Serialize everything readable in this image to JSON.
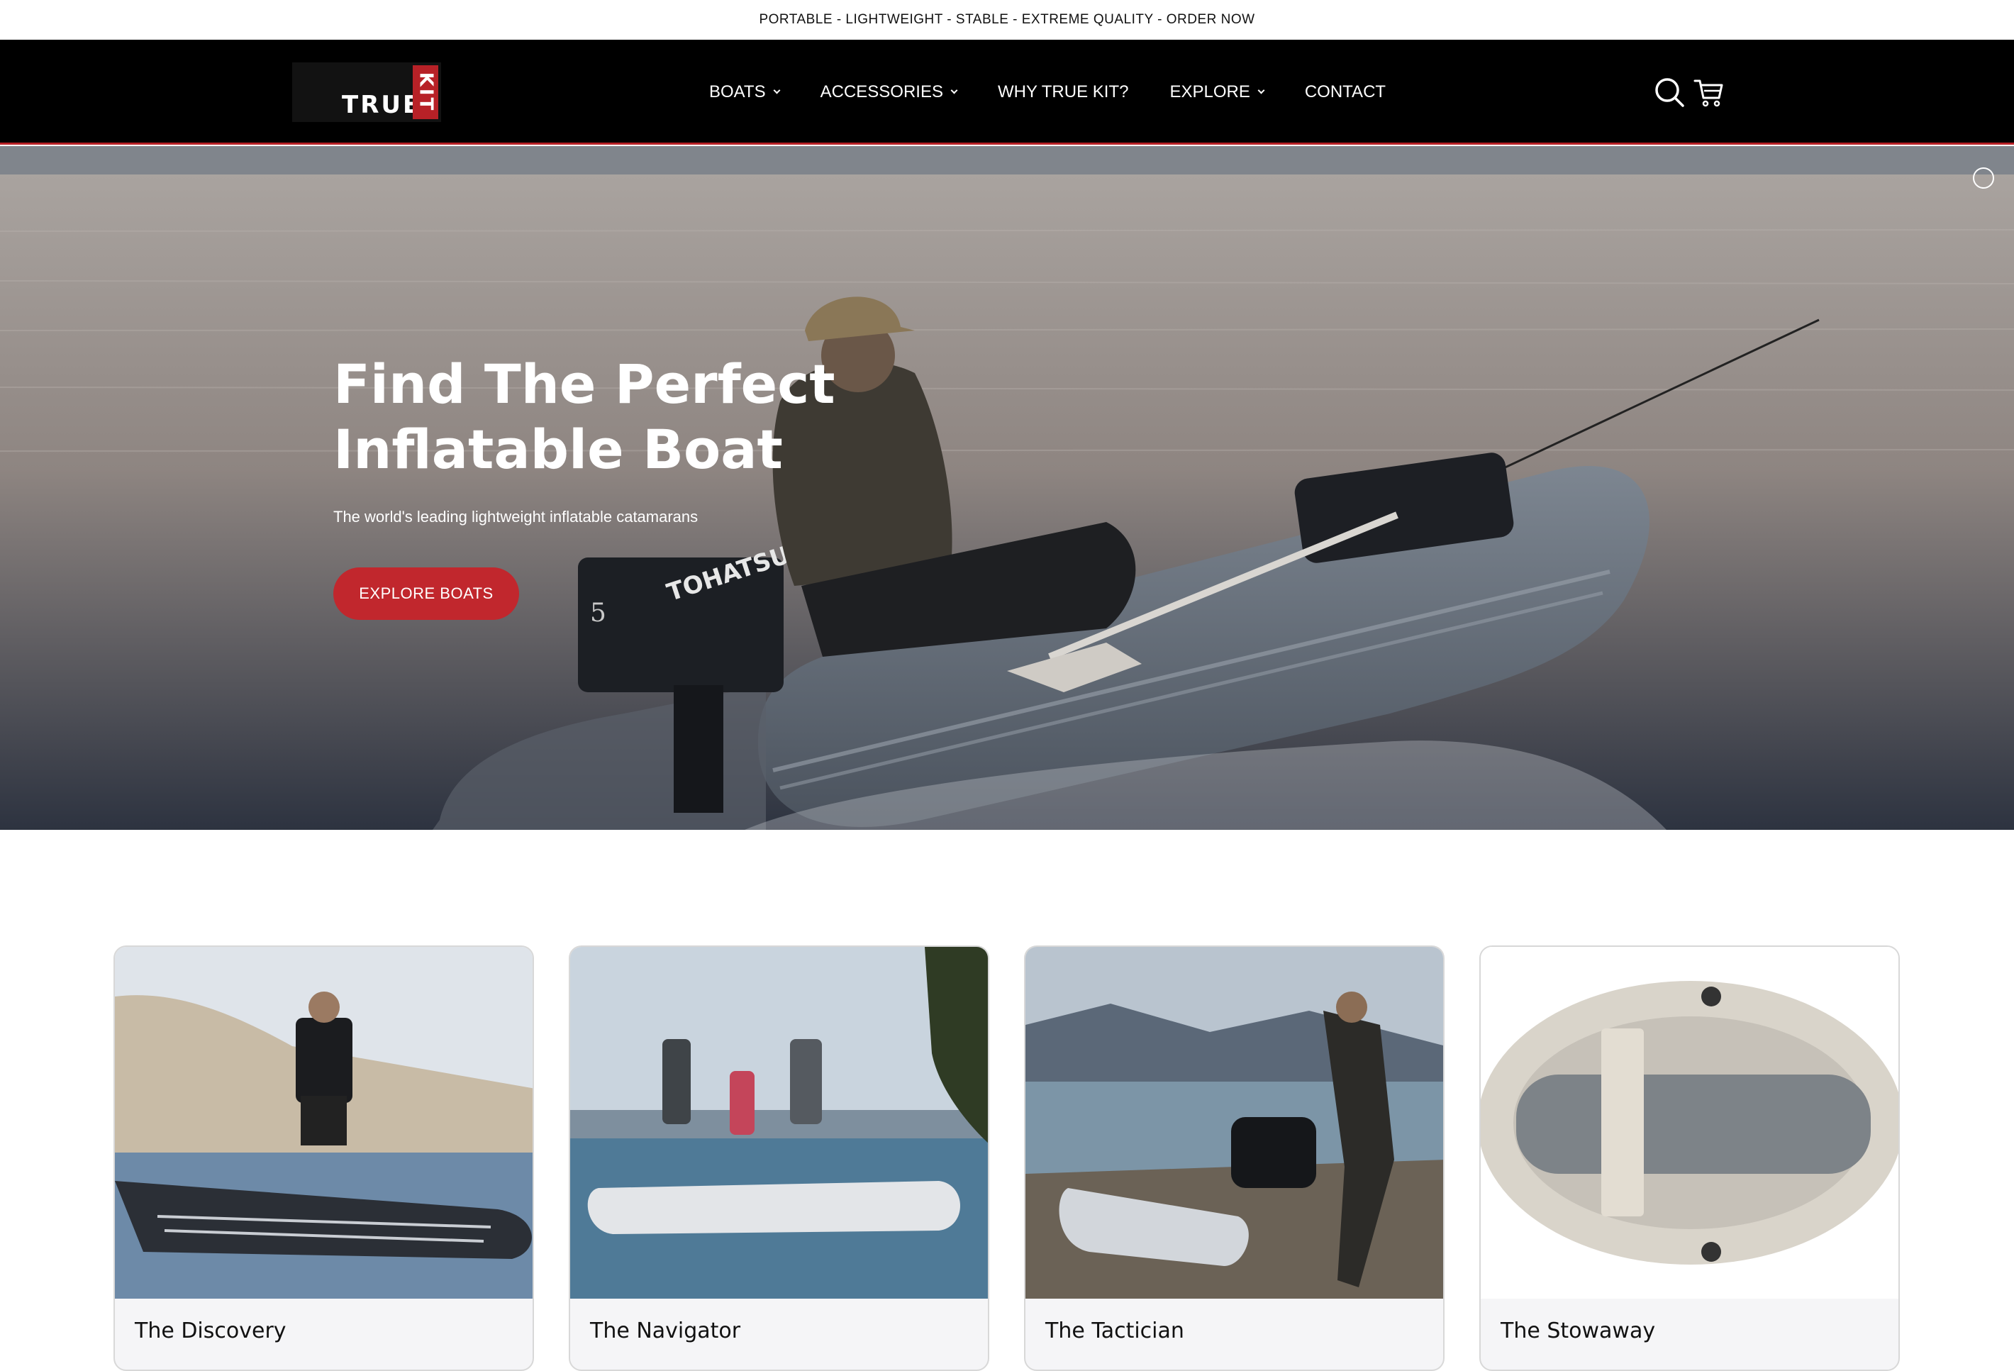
{
  "announcement": "PORTABLE - LIGHTWEIGHT - STABLE - EXTREME QUALITY - ORDER NOW",
  "brand": {
    "logo_word": "TRUE",
    "logo_mark": "KIT",
    "accent_color": "#c1272d"
  },
  "nav": {
    "items": [
      {
        "label": "BOATS",
        "has_dropdown": true
      },
      {
        "label": "ACCESSORIES",
        "has_dropdown": true
      },
      {
        "label": "WHY TRUE KIT?",
        "has_dropdown": false
      },
      {
        "label": "EXPLORE",
        "has_dropdown": true
      },
      {
        "label": "CONTACT",
        "has_dropdown": false
      }
    ],
    "icons": [
      "search-icon",
      "cart-icon"
    ]
  },
  "hero": {
    "title_line1": "Find The Perfect",
    "title_line2": "Inflatable Boat",
    "subtitle": "The world's leading lightweight inflatable catamarans",
    "cta_label": "EXPLORE BOATS",
    "motor_brand": "TOHATSU",
    "motor_number": "5"
  },
  "products": [
    {
      "name": "The Discovery"
    },
    {
      "name": "The Navigator"
    },
    {
      "name": "The Tactician"
    },
    {
      "name": "The Stowaway"
    }
  ]
}
